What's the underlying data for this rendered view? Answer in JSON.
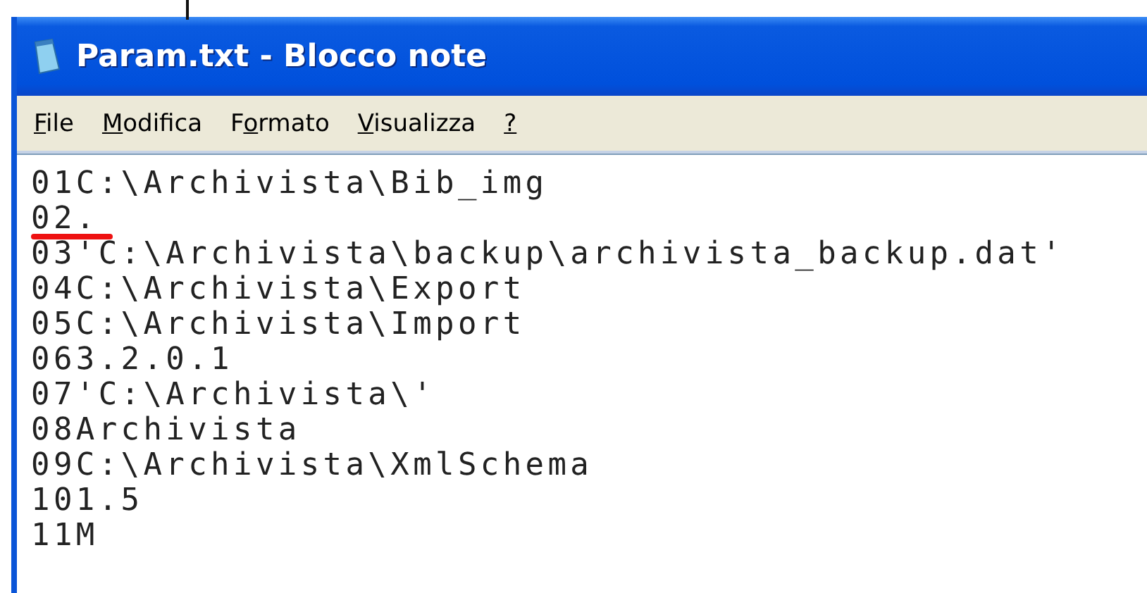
{
  "window": {
    "title": "Param.txt - Blocco note"
  },
  "menu": [
    {
      "parts": [
        {
          "text": "F",
          "underlined": true
        },
        {
          "text": "ile",
          "underlined": false
        }
      ]
    },
    {
      "parts": [
        {
          "text": "M",
          "underlined": true
        },
        {
          "text": "odifica",
          "underlined": false
        }
      ]
    },
    {
      "parts": [
        {
          "text": "F",
          "underlined": false
        },
        {
          "text": "o",
          "underlined": true
        },
        {
          "text": "rmato",
          "underlined": false
        }
      ]
    },
    {
      "parts": [
        {
          "text": "V",
          "underlined": true
        },
        {
          "text": "isualizza",
          "underlined": false
        }
      ]
    },
    {
      "parts": [
        {
          "text": "?",
          "underlined": true
        }
      ]
    }
  ],
  "editor": {
    "lines": [
      {
        "text": "01C:\\Archivista\\Bib_img",
        "red_underline": false
      },
      {
        "text": "02.",
        "red_underline": true
      },
      {
        "text": "03'C:\\Archivista\\backup\\archivista_backup.dat'",
        "red_underline": false
      },
      {
        "text": "04C:\\Archivista\\Export",
        "red_underline": false
      },
      {
        "text": "05C:\\Archivista\\Import",
        "red_underline": false
      },
      {
        "text": "063.2.0.1",
        "red_underline": false
      },
      {
        "text": "07'C:\\Archivista\\'",
        "red_underline": false
      },
      {
        "text": "08Archivista",
        "red_underline": false
      },
      {
        "text": "09C:\\Archivista\\XmlSchema",
        "red_underline": false
      },
      {
        "text": "101.5",
        "red_underline": false
      },
      {
        "text": "11M",
        "red_underline": false
      }
    ]
  }
}
